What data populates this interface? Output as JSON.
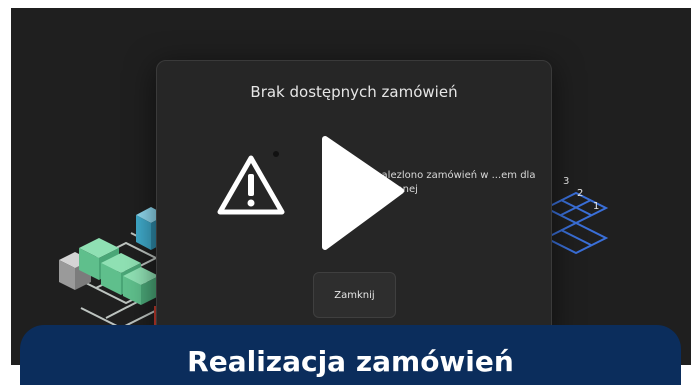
{
  "modal": {
    "title": "Brak dostępnych zamówień",
    "message": "...alezlono zamówień w ...em dla wybranej",
    "close_label": "Zamknij"
  },
  "scene": {
    "numbers": [
      "3",
      "2",
      "1"
    ]
  },
  "banner": {
    "title": "Realizacja zamówień"
  },
  "colors": {
    "video_bg": "#1f1f1f",
    "modal_bg": "#262626",
    "banner_bg": "#0b2d5c",
    "cube_green": "#5fbf8c",
    "cube_blue": "#3fa9c9",
    "grid_blue": "#3a6fd8"
  },
  "icons": {
    "warning": "warning-triangle-icon",
    "play": "play-icon"
  }
}
